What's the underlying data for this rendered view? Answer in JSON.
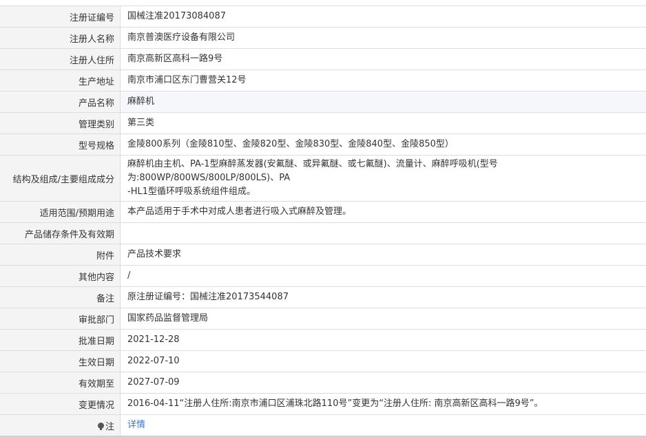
{
  "rows": [
    {
      "label": "注册证编号",
      "value": "国械注准20173084087"
    },
    {
      "label": "注册人名称",
      "value": "南京普澳医疗设备有限公司"
    },
    {
      "label": "注册人住所",
      "value": "南京高新区高科一路9号"
    },
    {
      "label": "生产地址",
      "value": "南京市浦口区东门曹营关12号"
    },
    {
      "label": "产品名称",
      "value": "麻醉机"
    },
    {
      "label": "管理类别",
      "value": "第三类"
    },
    {
      "label": "型号规格",
      "value": "金陵800系列（金陵810型、金陵820型、金陵830型、金陵840型、金陵850型）"
    },
    {
      "label": "结构及组成/主要组成成分",
      "value_line1": "麻醉机由主机、PA-1型麻醉蒸发器(安氟醚、或异氟醚、或七氟醚)、流量计、麻醉呼吸机(型号为:800WP/800WS/800LP/800LS)、PA",
      "value_line2": "-HL1型循环呼吸系统组件组成。"
    },
    {
      "label": "适用范围/预期用途",
      "value": "本产品适用于手术中对成人患者进行吸入式麻醉及管理。"
    },
    {
      "label": "产品储存条件及有效期",
      "value": ""
    },
    {
      "label": "附件",
      "value": "产品技术要求"
    },
    {
      "label": "其他内容",
      "value": "/"
    },
    {
      "label": "备注",
      "value": "原注册证编号：国械注准20173544087"
    },
    {
      "label": "审批部门",
      "value": "国家药品监督管理局"
    },
    {
      "label": "批准日期",
      "value": "2021-12-28"
    },
    {
      "label": "生效日期",
      "value": "2022-07-10"
    },
    {
      "label": "有效期至",
      "value": "2027-07-09"
    },
    {
      "label": "变更情况",
      "value": "2016-04-11“注册人住所:南京市浦口区浦珠北路110号”变更为“注册人住所: 南京高新区高科一路9号”。"
    },
    {
      "label": "注",
      "label_icon": "lightbulb-icon",
      "value": "详情"
    }
  ],
  "colors": {
    "label_bg": "#f4f4f4",
    "highlight_bg": "#f6f7fb",
    "border": "#dcdcdc",
    "link": "#3a73c8"
  }
}
